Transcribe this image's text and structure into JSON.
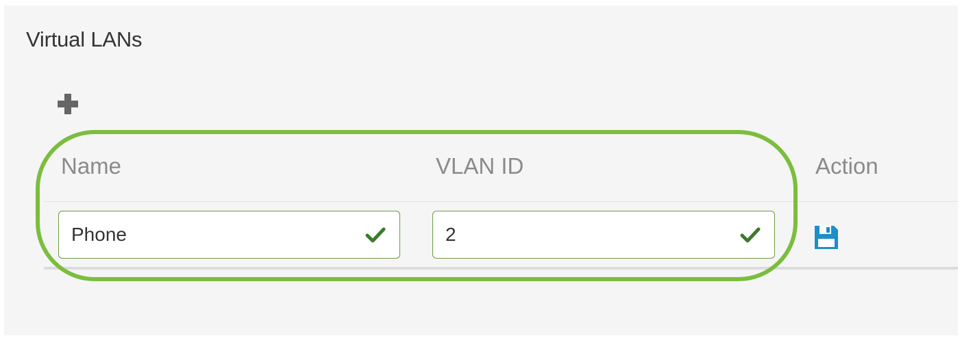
{
  "page": {
    "title": "Virtual LANs"
  },
  "toolbar": {
    "add_icon": "plus-icon"
  },
  "table": {
    "columns": [
      "Name",
      "VLAN ID",
      "Action"
    ],
    "row": {
      "name_value": "Phone",
      "vlan_id_value": "2",
      "name_valid_icon": "check-icon",
      "vlan_valid_icon": "check-icon",
      "action_icon": "floppy-disk-icon"
    }
  },
  "colors": {
    "highlight": "#7cbd3e",
    "valid": "#3c7a2e",
    "save_icon": "#1c8ec9",
    "header_text": "#8a8a8a",
    "field_border": "#6a9b3e"
  }
}
